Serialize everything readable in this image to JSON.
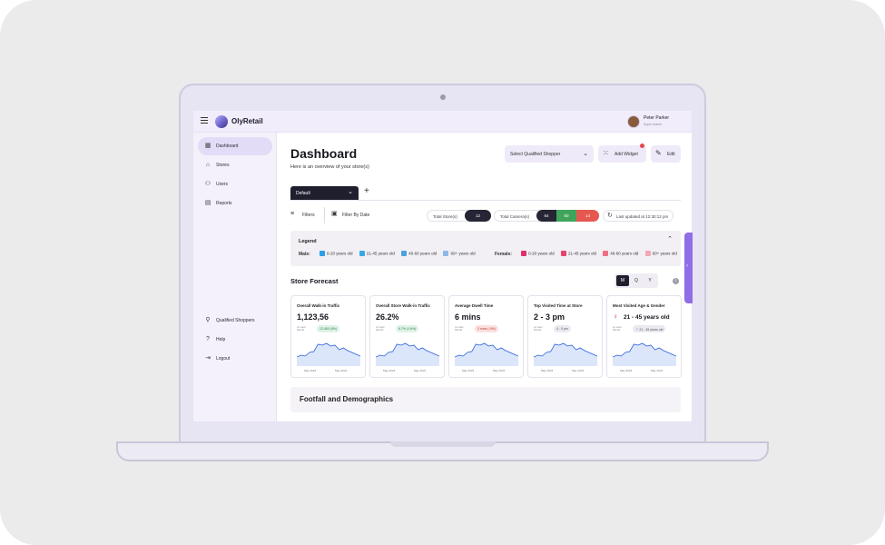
{
  "app": {
    "name": "OlyRetail",
    "user": {
      "name": "Peter Parker",
      "role": "Super Admin"
    }
  },
  "sidebar": {
    "items": [
      {
        "label": "Dashboard",
        "icon": "grid-icon",
        "active": true
      },
      {
        "label": "Stores",
        "icon": "store-icon"
      },
      {
        "label": "Users",
        "icon": "users-icon"
      },
      {
        "label": "Reports",
        "icon": "reports-icon"
      }
    ],
    "bottom_items": [
      {
        "label": "Qualified Shoppers",
        "icon": "shopper-icon"
      },
      {
        "label": "Help",
        "icon": "help-icon"
      },
      {
        "label": "Logout",
        "icon": "logout-icon"
      }
    ]
  },
  "header": {
    "title": "Dashboard",
    "subtitle": "Here is an overview of your store(s)",
    "select_shopper": "Select Qualified Shopper",
    "add_widget": "Add Widget",
    "edit": "Edit"
  },
  "tabs": {
    "active": "Default",
    "add": "+"
  },
  "filters": {
    "filters_label": "Filters",
    "date_label": "Filter By Date",
    "total_stores_label": "Total Store(s)",
    "total_stores_value": "12",
    "total_cameras_label": "Total Camera(s)",
    "cameras": [
      "64",
      "50",
      "14"
    ],
    "last_updated": "Last updated at 12:30:12 pm"
  },
  "legend": {
    "title": "Legend",
    "male_label": "Male:",
    "female_label": "Female:",
    "male": [
      {
        "label": "0-20 years old",
        "color": "#2e9ee6"
      },
      {
        "label": "21-45 years old",
        "color": "#3aa6e8"
      },
      {
        "label": "46-60 years old",
        "color": "#4fa0e0"
      },
      {
        "label": "60+ years old",
        "color": "#8fb8ea"
      }
    ],
    "female": [
      {
        "label": "0-20 years old",
        "color": "#e0306b"
      },
      {
        "label": "21-45 years old",
        "color": "#e6456f"
      },
      {
        "label": "46-60 years old",
        "color": "#ee6f86"
      },
      {
        "label": "60+ years old",
        "color": "#f2a6b6"
      }
    ]
  },
  "forecast": {
    "title": "Store Forecast",
    "periods": [
      "M",
      "Q",
      "Y"
    ],
    "active_period": "M",
    "cards": [
      {
        "title": "Overall Walk-in Traffic",
        "value": "1,123,56",
        "sub": "vs Last Month",
        "badge": "12,460 (9%)",
        "badge_type": "green",
        "x_start": "May 2023",
        "x_end": "May 2024"
      },
      {
        "title": "Overall Store Walk-in Traffic",
        "value": "26.2%",
        "sub": "vs Last Month",
        "badge": "6.7% (1.6%)",
        "badge_type": "green",
        "x_start": "May 2023",
        "x_end": "May 2024"
      },
      {
        "title": "Average Dwell Time",
        "value": "6 mins",
        "sub": "vs Last Month",
        "badge": "2 mins (-9%)",
        "badge_type": "red",
        "x_start": "May 2023",
        "x_end": "May 2024"
      },
      {
        "title": "Top Visited Time at Store",
        "value": "2 - 3 pm",
        "sub": "vs Last Month",
        "badge": "4 - 5 pm",
        "badge_type": "gray",
        "x_start": "May 2023",
        "x_end": "May 2024"
      },
      {
        "title": "Most Visited Age & Gender",
        "value": "21 - 45 years old",
        "sub": "vs Last Month",
        "badge": "21 - 45 years old",
        "badge_type": "gray",
        "x_start": "May 2023",
        "x_end": "May 2024"
      }
    ]
  },
  "footfall": {
    "title": "Footfall and Demographics"
  },
  "colors": {
    "accent": "#1f1f2e",
    "brand": "#8f6ee8",
    "sidebar_bg": "#f4f1fb",
    "chart_line": "#2b5fd9",
    "chart_fill": "#dce6fb"
  }
}
